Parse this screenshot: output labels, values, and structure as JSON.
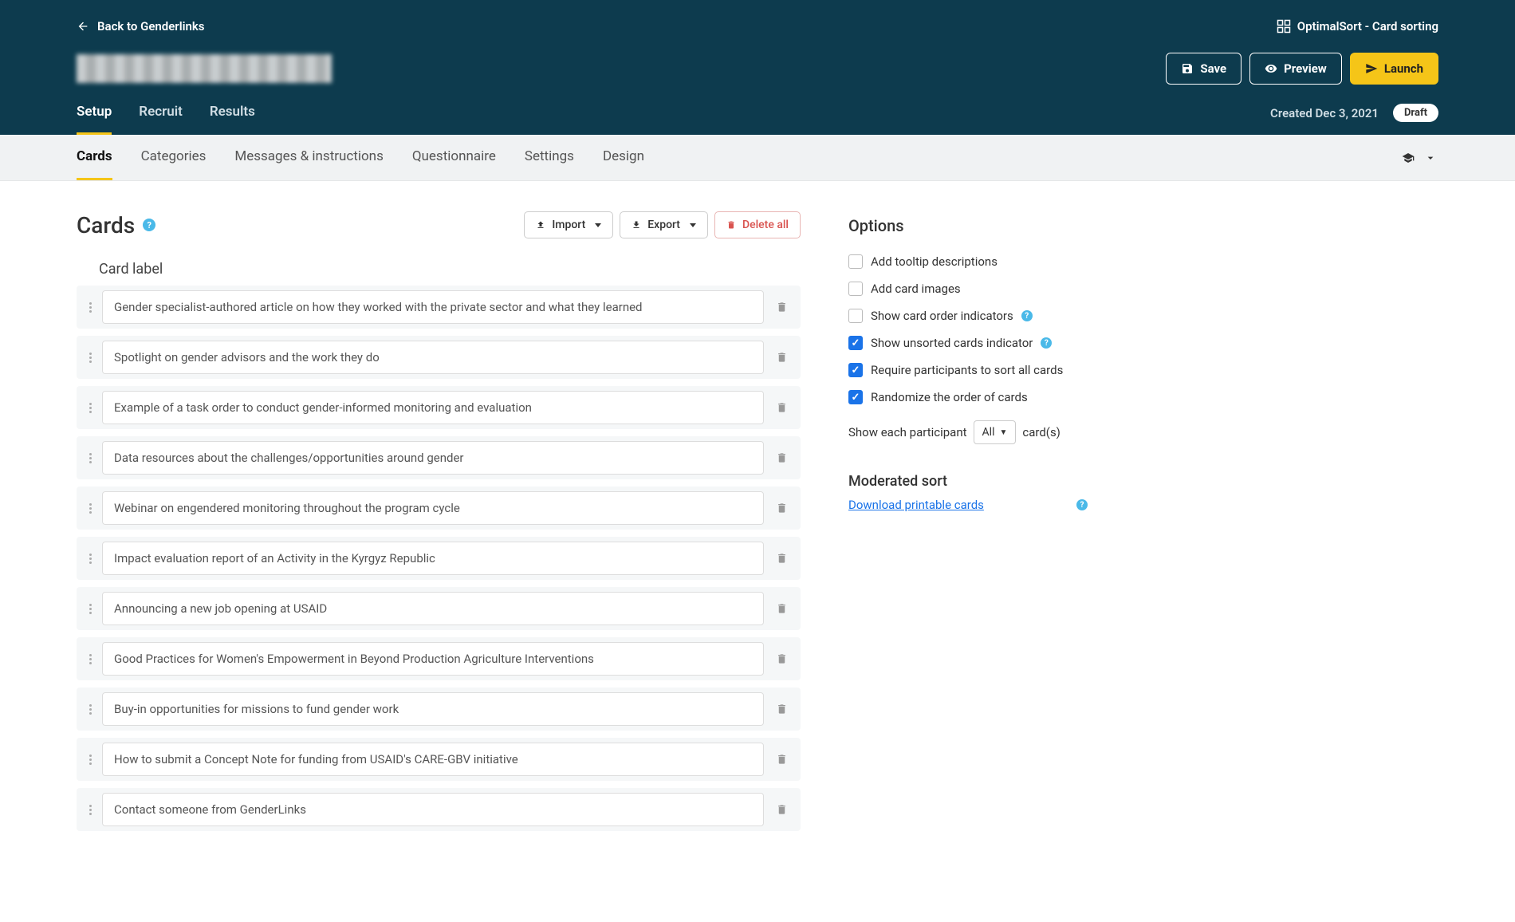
{
  "header": {
    "back_label": "Back to Genderlinks",
    "brand": "OptimalSort - Card sorting",
    "actions": {
      "save": "Save",
      "preview": "Preview",
      "launch": "Launch"
    },
    "created": "Created Dec 3, 2021",
    "status": "Draft"
  },
  "main_tabs": [
    "Setup",
    "Recruit",
    "Results"
  ],
  "main_tab_active": 0,
  "sub_tabs": [
    "Cards",
    "Categories",
    "Messages & instructions",
    "Questionnaire",
    "Settings",
    "Design"
  ],
  "sub_tab_active": 0,
  "page": {
    "title": "Cards",
    "import": "Import",
    "export": "Export",
    "delete_all": "Delete all",
    "label_header": "Card label"
  },
  "cards": [
    "Gender specialist-authored article on how they worked with the private sector and what they learned",
    "Spotlight on gender advisors and the work they do",
    "Example of a task order to conduct gender-informed monitoring and evaluation",
    "Data resources about the challenges/opportunities around gender",
    "Webinar on engendered monitoring throughout the program cycle",
    "Impact evaluation report of an Activity in the Kyrgyz Republic",
    "Announcing a new job opening at USAID",
    "Good Practices for Women's Empowerment in Beyond Production Agriculture Interventions",
    "Buy-in opportunities for missions to fund gender work",
    "How to submit a Concept Note for funding from USAID's CARE-GBV initiative",
    "Contact someone from GenderLinks"
  ],
  "options": {
    "title": "Options",
    "items": [
      {
        "label": "Add tooltip descriptions",
        "checked": false,
        "help": false
      },
      {
        "label": "Add card images",
        "checked": false,
        "help": false
      },
      {
        "label": "Show card order indicators",
        "checked": false,
        "help": true
      },
      {
        "label": "Show unsorted cards indicator",
        "checked": true,
        "help": true
      },
      {
        "label": "Require participants to sort all cards",
        "checked": true,
        "help": false
      },
      {
        "label": "Randomize the order of cards",
        "checked": true,
        "help": false
      }
    ],
    "show_each_prefix": "Show each participant",
    "show_each_select": "All",
    "show_each_suffix": "card(s)",
    "moderated_title": "Moderated sort",
    "download_link": "Download printable cards"
  }
}
